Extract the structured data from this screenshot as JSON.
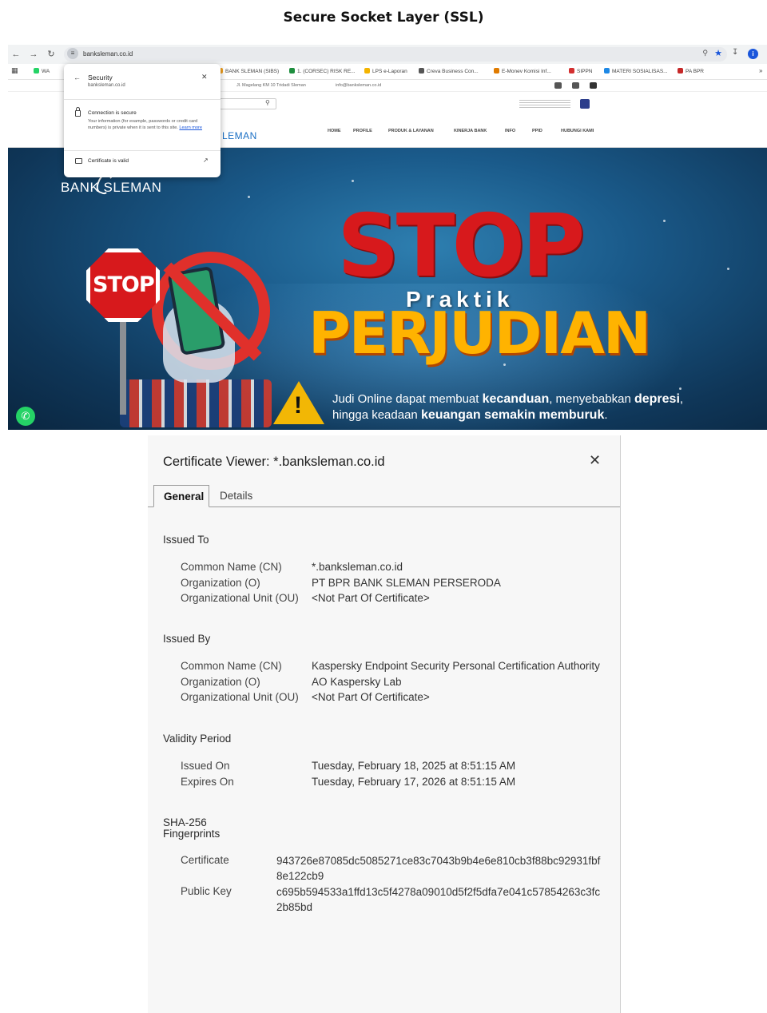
{
  "doc_title": "Secure Socket Layer (SSL)",
  "browser": {
    "url": "banksleman.co.id",
    "bookmarks": [
      "WA",
      "BANK SLEMAN (SIBS)",
      "1. (CORSEC) RISK RE...",
      "LPS e-Laporan",
      "Creva Business Con...",
      "E-Monev Komisi Inf...",
      "SIPPN",
      "MATERI SOSIALISAS...",
      "PA BPR"
    ],
    "topbar_address": "Jl. Magelang KM 10 Tridadi Sleman",
    "topbar_email": "info@banksleman.co.id",
    "site_logo_partial": "LEMAN",
    "menu": [
      "HOME",
      "PROFILE",
      "PRODUK & LAYANAN",
      "KINERJA BANK",
      "INFO",
      "PPID",
      "HUBUNGI KAMI"
    ],
    "hero": {
      "brand": "BANK SLEMAN",
      "stop_sign": "STOP",
      "stop_big": "STOP",
      "praktik": "Praktik",
      "perjudian": "PERJUDIAN",
      "caption_line1_a": "Judi Online dapat membuat ",
      "caption_line1_b": "kecanduan",
      "caption_line1_c": ", menyebabkan ",
      "caption_line1_d": "depresi",
      "caption_line1_e": ",",
      "caption_line2_a": "hingga keadaan ",
      "caption_line2_b": "keuangan semakin memburuk",
      "caption_line2_c": "."
    },
    "security_popup": {
      "title": "Security",
      "domain": "banksleman.co.id",
      "connection": "Connection is secure",
      "body": "Your information (for example, passwords or credit card numbers) is private when it is sent to this site.",
      "learn_more": "Learn more",
      "certificate": "Certificate is valid"
    }
  },
  "cert": {
    "title": "Certificate Viewer: *.banksleman.co.id",
    "tabs": [
      "General",
      "Details"
    ],
    "issued_to": {
      "heading": "Issued To",
      "rows": [
        {
          "label": "Common Name (CN)",
          "value": "*.banksleman.co.id"
        },
        {
          "label": "Organization (O)",
          "value": "PT BPR BANK SLEMAN PERSERODA"
        },
        {
          "label": "Organizational Unit (OU)",
          "value": "<Not Part Of Certificate>"
        }
      ]
    },
    "issued_by": {
      "heading": "Issued By",
      "rows": [
        {
          "label": "Common Name (CN)",
          "value": "Kaspersky Endpoint Security Personal Certification Authority"
        },
        {
          "label": "Organization (O)",
          "value": "AO Kaspersky Lab"
        },
        {
          "label": "Organizational Unit (OU)",
          "value": "<Not Part Of Certificate>"
        }
      ]
    },
    "validity": {
      "heading": "Validity Period",
      "rows": [
        {
          "label": "Issued On",
          "value": "Tuesday, February 18, 2025 at 8:51:15 AM"
        },
        {
          "label": "Expires On",
          "value": "Tuesday, February 17, 2026 at 8:51:15 AM"
        }
      ]
    },
    "fingerprints": {
      "heading1": "SHA-256",
      "heading2": "Fingerprints",
      "rows": [
        {
          "label": "Certificate",
          "value": "943726e87085dc5085271ce83c7043b9b4e6e810cb3f88bc92931fbf8e122cb9"
        },
        {
          "label": "Public Key",
          "value": "c695b594533a1ffd13c5f4278a09010d5f2f5dfa7e041c57854263c3fc2b85bd"
        }
      ]
    }
  }
}
